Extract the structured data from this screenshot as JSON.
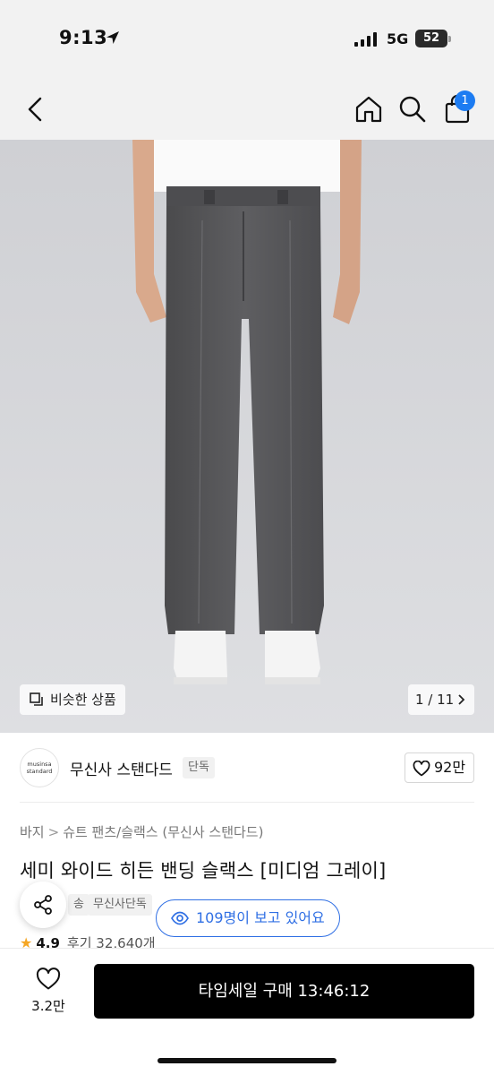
{
  "status_bar": {
    "time": "9:13",
    "network": "5G",
    "battery": "52",
    "icons": [
      "location-arrow-icon",
      "signal-icon",
      "battery-icon"
    ]
  },
  "nav": {
    "icons": [
      "chevron-left-icon",
      "home-icon",
      "search-icon",
      "shopping-bag-icon"
    ],
    "cart_count": "1"
  },
  "gallery": {
    "similar_label": "비슷한 상품",
    "pager": "1 / 11"
  },
  "brand": {
    "logo_line1": "musinsa",
    "logo_line2": "standard",
    "name": "무신사 스탠다드",
    "tag": "단독",
    "likes": "92만"
  },
  "product": {
    "breadcrumb": [
      "바지",
      "슈트 팬츠/슬랙스 (무신사 스탠다드)"
    ],
    "title": "세미 와이드 히든 밴딩 슬랙스 [미디엄 그레이]",
    "tags": [
      "송",
      "무신사단독"
    ],
    "rating": "4.9",
    "review_text": "후기 32,640개"
  },
  "viewers": "109명이 보고 있어요",
  "bottom": {
    "wish_count": "3.2만",
    "buy_label": "타임세일 구매 13:46:12"
  },
  "colors": {
    "accent_blue": "#2f6fe4",
    "badge_blue": "#1d7cf2",
    "buy_button": "#000000",
    "star": "#f5a623"
  }
}
